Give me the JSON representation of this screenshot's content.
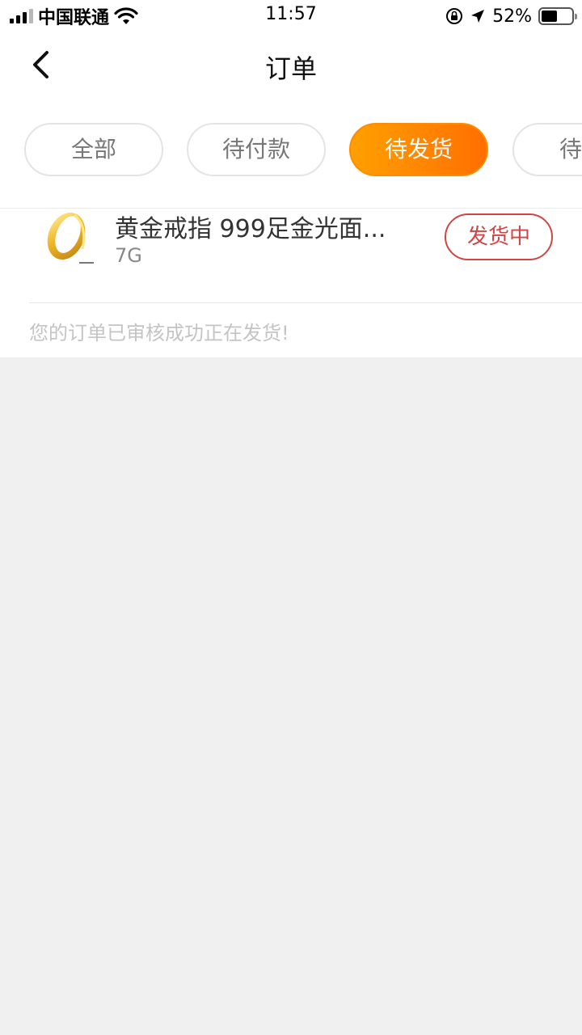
{
  "status_bar": {
    "carrier": "中国联通",
    "time": "11:57",
    "battery_percent": "52%",
    "battery_level": 0.52
  },
  "nav": {
    "title": "订单",
    "back_icon": "chevron-left-icon"
  },
  "tabs": [
    {
      "label": "全部",
      "active": false
    },
    {
      "label": "待付款",
      "active": false
    },
    {
      "label": "待发货",
      "active": true
    },
    {
      "label": "待收",
      "active": false
    }
  ],
  "colors": {
    "accent_start": "#ffa000",
    "accent_end": "#ff6f00",
    "status_red": "#d04545",
    "background": "#f0f0f0"
  },
  "order": {
    "product_title": "黄金戒指 999足金光面...",
    "product_spec": "7G",
    "status": "发货中",
    "note": "您的订单已审核成功正在发货!"
  }
}
